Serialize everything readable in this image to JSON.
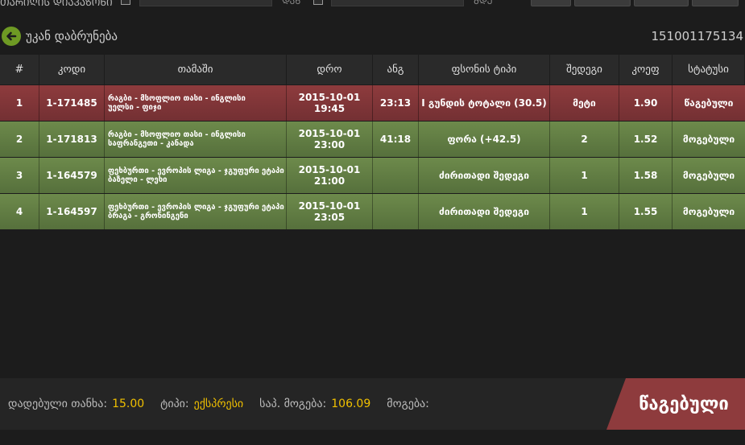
{
  "topbar": {
    "label": "ᲗᲐᲠᲘᲦᲘᲡ ᲓᲘᲐᲞᲐᲖᲝᲜᲘ",
    "from_sep": "ᲓᲐᲜ",
    "to_sep": "ᲛᲓᲔ"
  },
  "header": {
    "back_label": "უკან დაბრუნება",
    "ticket_id": "151001175134"
  },
  "table": {
    "columns": [
      "#",
      "კოდი",
      "თამაში",
      "დრო",
      "ანგ",
      "ფსონის ტიპი",
      "შედეგი",
      "კოეფ",
      "სტატუსი"
    ],
    "rows": [
      {
        "num": "1",
        "code": "1-171485",
        "game": "რაგბი - მსოფლიო თასი - ინგლისი\nუელსი - ფიჯი",
        "date": "2015-10-01 19:45",
        "score": "23:13",
        "type": "I გუნდის ტოტალი (30.5)",
        "result": "მეტი",
        "odd": "1.90",
        "status": "წაგებული"
      },
      {
        "num": "2",
        "code": "1-171813",
        "game": "რაგბი - მსოფლიო თასი - ინგლისი\nსაფრანგეთი - კანადა",
        "date": "2015-10-01 23:00",
        "score": "41:18",
        "type": "ფორა (+42.5)",
        "result": "2",
        "odd": "1.52",
        "status": "მოგებული"
      },
      {
        "num": "3",
        "code": "1-164579",
        "game": "ფეხბურთი - ევროპის ლიგა - ჯგუფური ეტაპი\nბაზელი - ლეხი",
        "date": "2015-10-01 21:00",
        "score": "",
        "type": "ძირითადი შედეგი",
        "result": "1",
        "odd": "1.58",
        "status": "მოგებული"
      },
      {
        "num": "4",
        "code": "1-164597",
        "game": "ფეხბურთი - ევროპის ლიგა - ჯგუფური ეტაპი\nბრაგა - გრონინგენი",
        "date": "2015-10-01 23:05",
        "score": "",
        "type": "ძირითადი შედეგი",
        "result": "1",
        "odd": "1.55",
        "status": "მოგებული"
      }
    ]
  },
  "footer": {
    "stake_label": "დადებული თანხა:",
    "stake_value": "15.00",
    "type_label": "ტიპი:",
    "type_value": "ექსპრესი",
    "potential_label": "საპ. მოგება:",
    "potential_value": "106.09",
    "win_label": "მოგება:",
    "win_value": "",
    "status": "წაგებული"
  },
  "colors": {
    "lost": "#8e3b3d",
    "won": "#6d8a4b",
    "accent": "#f0c000",
    "back_icon": "#6e9a24"
  }
}
